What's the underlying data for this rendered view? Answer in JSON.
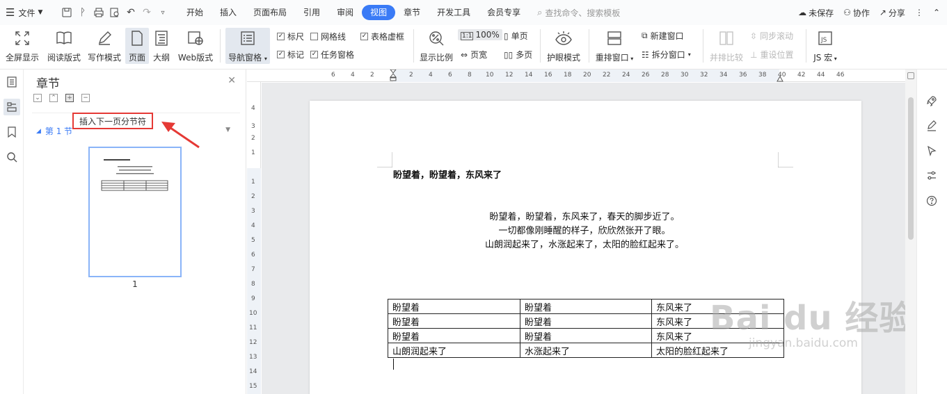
{
  "menubar": {
    "file_label": "文件",
    "tabs": [
      "开始",
      "插入",
      "页面布局",
      "引用",
      "审阅",
      "视图",
      "章节",
      "开发工具",
      "会员专享"
    ],
    "active_tab": "视图",
    "search_placeholder": "查找命令、搜索模板",
    "unsaved": "未保存",
    "collaborate": "协作",
    "share": "分享"
  },
  "ribbon": {
    "fullscreen": "全屏显示",
    "reading": "阅读版式",
    "writing": "写作模式",
    "page": "页面",
    "outline": "大纲",
    "web": "Web版式",
    "nav_pane": "导航窗格",
    "ruler": "标尺",
    "gridlines": "网格线",
    "table_dashes": "表格虚框",
    "marks": "标记",
    "task_pane": "任务窗格",
    "zoom_ratio": "显示比例",
    "zoom_value": "100%",
    "page_width": "页宽",
    "single_page": "单页",
    "multi_page": "多页",
    "eye_mode": "护眼模式",
    "rearrange": "重排窗口",
    "new_window": "新建窗口",
    "split_window": "拆分窗口",
    "side_by_side": "并排比较",
    "sync_scroll": "同步滚动",
    "reset_position": "重设位置",
    "js_macro": "JS 宏",
    "checks": {
      "ruler": true,
      "gridlines": false,
      "table_dashes": true,
      "marks": true,
      "task_pane": true
    }
  },
  "panel": {
    "title": "章节",
    "section_label": "第 1 节",
    "section_suffix": "",
    "tooltip": "插入下一页分节符",
    "page_number": "1"
  },
  "ruler": {
    "h_ticks": [
      "6",
      "4",
      "2",
      "2",
      "4",
      "6",
      "8",
      "10",
      "12",
      "14",
      "16",
      "18",
      "20",
      "22",
      "24",
      "26",
      "28",
      "30",
      "32",
      "34",
      "36",
      "38",
      "40",
      "42",
      "44",
      "46"
    ],
    "v_ticks": [
      "4",
      "3",
      "2",
      "1",
      "1",
      "2",
      "3",
      "4",
      "5",
      "6",
      "7",
      "8",
      "9",
      "10",
      "11",
      "12",
      "13",
      "14",
      "15"
    ]
  },
  "document": {
    "title": "盼望着，盼望着，东风来了",
    "poem": [
      "盼望着，盼望着，东风来了，春天的脚步近了。",
      "一切都像刚睡醒的样子，欣欣然张开了眼。",
      "山朗润起来了，水涨起来了，太阳的脸红起来了。"
    ],
    "table": [
      [
        "盼望着",
        "盼望着",
        "东风来了"
      ],
      [
        "盼望着",
        "盼望着",
        "东风来了"
      ],
      [
        "盼望着",
        "盼望着",
        "东风来了"
      ],
      [
        "山朗润起来了",
        "水涨起来了",
        "太阳的脸红起来了"
      ]
    ]
  },
  "watermark": {
    "big": "Bai du 经验",
    "small": "jingyan.baidu.com"
  },
  "colors": {
    "accent": "#3a7bf6",
    "highlight": "#e53935"
  }
}
